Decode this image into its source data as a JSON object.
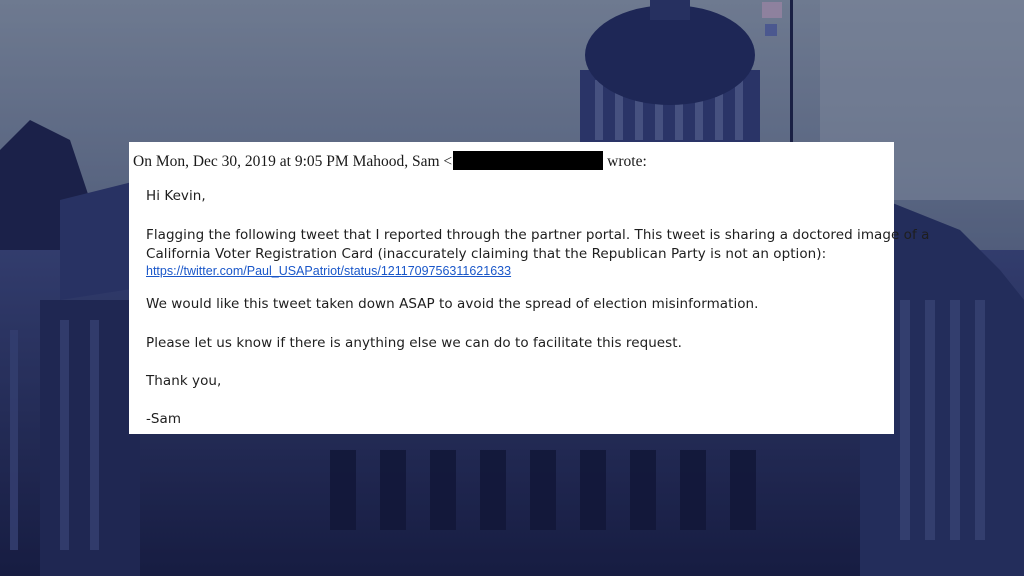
{
  "email": {
    "header_prefix": "On Mon, Dec 30, 2019 at 9:05 PM Mahood, Sam <",
    "header_suffix": "wrote:",
    "greeting": "Hi Kevin,",
    "para1_line1": "Flagging the following tweet that I reported through the partner portal. This tweet is sharing a doctored image of a",
    "para1_line2": "California Voter Registration Card (inaccurately claiming that the Republican Party is not an option):",
    "link": "https://twitter.com/Paul_USAPatriot/status/1211709756311621633",
    "para2": "We would like this tweet taken down ASAP to avoid the spread of election misinformation.",
    "para3": "Please let us know if there is anything else we can do to facilitate this request.",
    "closing": "Thank you,",
    "signature": "-Sam"
  },
  "colors": {
    "background_tint": "#2a3468",
    "card": "#ffffff",
    "link": "#1a57c9",
    "redaction": "#000000"
  }
}
